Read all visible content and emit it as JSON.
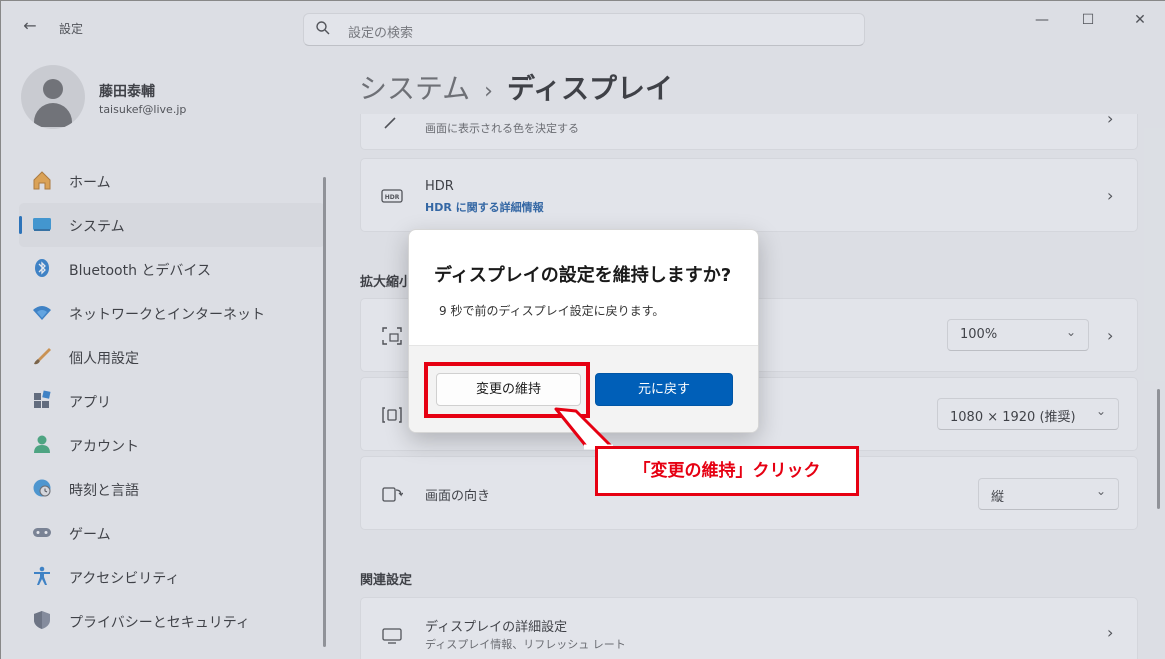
{
  "window": {
    "app_title": "設定",
    "search_placeholder": "設定の検索",
    "controls": {
      "minimize": "—",
      "maximize": "☐",
      "close": "✕"
    }
  },
  "profile": {
    "name": "藤田泰輔",
    "email": "taisukef@live.jp"
  },
  "sidebar": {
    "items": [
      {
        "label": "ホーム",
        "icon": "home-icon"
      },
      {
        "label": "システム",
        "icon": "system-icon",
        "active": true
      },
      {
        "label": "Bluetooth とデバイス",
        "icon": "bluetooth-icon"
      },
      {
        "label": "ネットワークとインターネット",
        "icon": "wifi-icon"
      },
      {
        "label": "個人用設定",
        "icon": "brush-icon"
      },
      {
        "label": "アプリ",
        "icon": "apps-icon"
      },
      {
        "label": "アカウント",
        "icon": "account-icon"
      },
      {
        "label": "時刻と言語",
        "icon": "globe-clock-icon"
      },
      {
        "label": "ゲーム",
        "icon": "gamepad-icon"
      },
      {
        "label": "アクセシビリティ",
        "icon": "accessibility-icon"
      },
      {
        "label": "プライバシーとセキュリティ",
        "icon": "shield-icon"
      }
    ]
  },
  "breadcrumb": {
    "parent": "システム",
    "separator": "›",
    "current": "ディスプレイ"
  },
  "content": {
    "color_profile": {
      "subtitle": "画面に表示される色を決定する"
    },
    "hdr": {
      "title": "HDR",
      "link": "HDR に関する詳細情報"
    },
    "scale_section_title": "拡大縮小",
    "scale": {
      "value": "100%"
    },
    "resolution": {
      "value": "1080 × 1920 (推奨)"
    },
    "orientation": {
      "title": "画面の向き",
      "value": "縦"
    },
    "related_title": "関連設定",
    "advanced": {
      "title": "ディスプレイの詳細設定",
      "subtitle": "ディスプレイ情報、リフレッシュ レート"
    }
  },
  "dialog": {
    "title": "ディスプレイの設定を維持しますか?",
    "message": "9 秒で前のディスプレイ設定に戻ります。",
    "keep_label": "変更の維持",
    "revert_label": "元に戻す"
  },
  "annotation": {
    "callout_text": "「変更の維持」クリック",
    "color": "#e60012"
  },
  "colors": {
    "accent": "#005fb8",
    "annotation_red": "#e60012"
  }
}
